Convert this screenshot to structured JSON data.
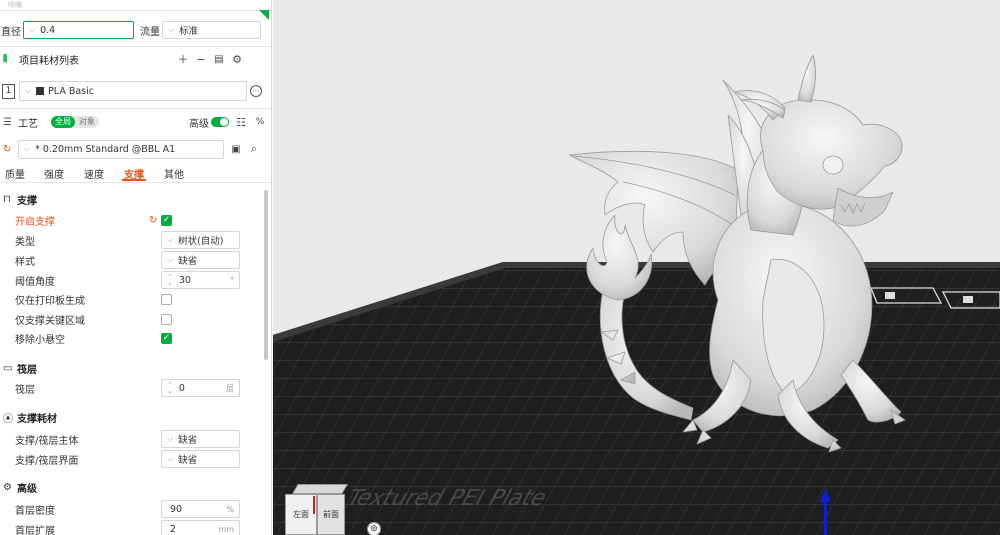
{
  "nozzle": {
    "top_label": "喷嘴",
    "diameter_label": "直径",
    "diameter_value": "0.4",
    "flow_label": "流量",
    "flow_value": "标准"
  },
  "filament": {
    "section_title": "项目耗材列表",
    "slot_number": "1",
    "name": "PLA Basic"
  },
  "process": {
    "title": "工艺",
    "toggle_global": "全局",
    "toggle_object": "对象",
    "advanced_label": "高级",
    "preset_name": "* 0.20mm Standard @BBL A1"
  },
  "tabs": [
    "质量",
    "强度",
    "速度",
    "支撑",
    "其他"
  ],
  "active_tab": "支撑",
  "support": {
    "section_title": "支撑",
    "enable_label": "开启支撑",
    "type_label": "类型",
    "type_value": "树状(自动)",
    "style_label": "样式",
    "style_value": "缺省",
    "threshold_label": "阈值角度",
    "threshold_value": "30",
    "threshold_unit": "°",
    "buildplate_only_label": "仅在打印板生成",
    "critical_only_label": "仅支撑关键区域",
    "remove_small_overhang_label": "移除小悬空"
  },
  "raft": {
    "section_title": "筏层",
    "layers_label": "筏层",
    "layers_value": "0",
    "layers_unit": "层"
  },
  "support_filament": {
    "section_title": "支撑耗材",
    "base_label": "支撑/筏层主体",
    "base_value": "缺省",
    "interface_label": "支撑/筏层界面",
    "interface_value": "缺省"
  },
  "advanced": {
    "section_title": "高级",
    "first_layer_density_label": "首层密度",
    "first_layer_density_value": "90",
    "first_layer_density_unit": "%",
    "first_layer_expansion_label": "首层扩展",
    "first_layer_expansion_value": "2",
    "first_layer_expansion_unit": "mm"
  },
  "viewcube": {
    "left_face": "左面",
    "front_face": "前面"
  },
  "plate_text": "Textured PEI Plate",
  "colors": {
    "accent_green": "#00ae42",
    "active_orange": "#e8551f",
    "viewport_bg": "#e9e9e9",
    "bed_color": "#1f1f1f",
    "model_color": "#dcdcdc"
  },
  "icons": [
    "grip-icon",
    "add-icon",
    "minus-icon",
    "save-icon",
    "settings-icon",
    "process-icon",
    "list-icon",
    "compare-icon",
    "reset-icon",
    "search-icon",
    "support-icon",
    "raft-icon",
    "support-filament-icon",
    "advanced-icon",
    "more-icon"
  ]
}
